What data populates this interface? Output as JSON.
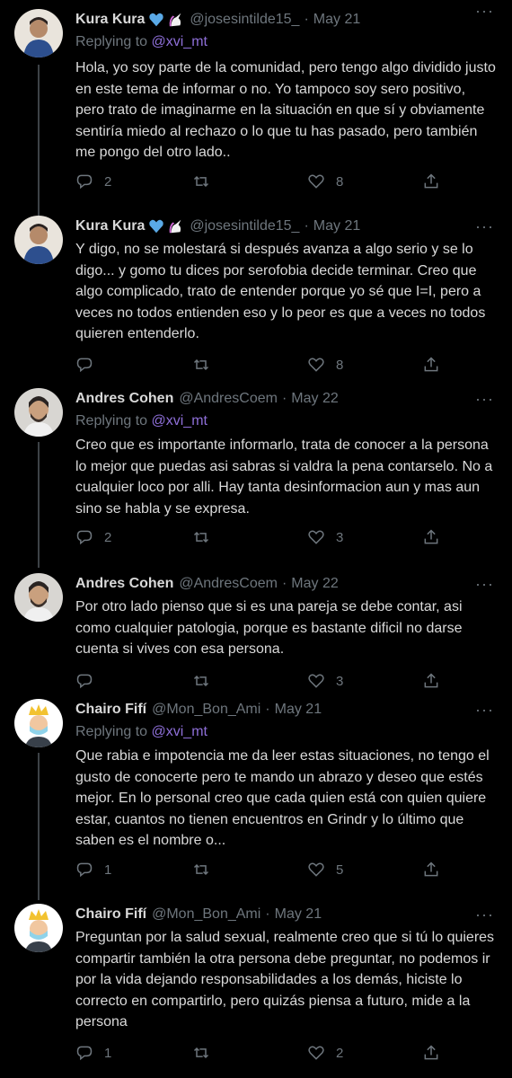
{
  "tweets": [
    {
      "name": "Kura Kura",
      "handle": "@josesintilde15_",
      "date": "May 21",
      "reply_prefix": "Replying to",
      "reply_to": "@xvi_mt",
      "text": "Hola, yo soy parte de la comunidad, pero tengo algo dividido justo en este tema de informar o no. Yo tampoco soy sero positivo, pero trato de imaginarme en la situación en que sí y obviamente sentiría miedo al rechazo o lo que tu has pasado, pero también me pongo del otro lado..",
      "replies": "2",
      "retweets": "",
      "likes": "8"
    },
    {
      "name": "Kura Kura",
      "handle": "@josesintilde15_",
      "date": "May 21",
      "text": "Y digo, no se molestará si después avanza a algo serio y se lo digo... y gomo tu dices por serofobia decide terminar. Creo que algo complicado, trato de entender porque yo sé que I=I, pero a veces no todos entienden eso y lo peor es que a veces no todos quieren entenderlo.",
      "replies": "",
      "retweets": "",
      "likes": "8"
    },
    {
      "name": "Andres Cohen",
      "handle": "@AndresCoem",
      "date": "May 22",
      "reply_prefix": "Replying to",
      "reply_to": "@xvi_mt",
      "text": "Creo que es importante informarlo, trata de conocer a la persona lo mejor que puedas asi sabras si valdra la pena contarselo. No a cualquier loco por alli. Hay tanta desinformacion aun y mas aun sino se habla y se expresa.",
      "replies": "2",
      "retweets": "",
      "likes": "3"
    },
    {
      "name": "Andres Cohen",
      "handle": "@AndresCoem",
      "date": "May 22",
      "text": "Por otro lado pienso que si es una pareja se debe contar, asi como cualquier patologia, porque es bastante dificil no darse cuenta si vives con esa persona.",
      "replies": "",
      "retweets": "",
      "likes": "3"
    },
    {
      "name": "Chairo Fifí",
      "handle": "@Mon_Bon_Ami",
      "date": "May 21",
      "reply_prefix": "Replying to",
      "reply_to": "@xvi_mt",
      "text": "Que rabia e impotencia me da leer estas situaciones, no tengo el gusto de conocerte pero te mando un abrazo y deseo que estés mejor. En lo personal creo que cada quien está con quien quiere estar, cuantos no tienen encuentros en Grindr y lo último que saben es el nombre o...",
      "replies": "1",
      "retweets": "",
      "likes": "5"
    },
    {
      "name": "Chairo Fifí",
      "handle": "@Mon_Bon_Ami",
      "date": "May 21",
      "text": "Preguntan por la salud sexual, realmente creo que si tú lo quieres compartir también la otra persona debe preguntar, no podemos ir por la vida dejando responsabilidades a los demás, hiciste lo correcto en compartirlo, pero quizás piensa a futuro, mide a la persona",
      "replies": "1",
      "retweets": "",
      "likes": "2"
    }
  ],
  "separator": "·",
  "more": "···",
  "icons": {
    "reply": "reply-icon",
    "retweet": "retweet-icon",
    "like": "heart-icon",
    "share": "share-icon",
    "blue_heart": "blue-heart-icon",
    "unicorn": "unicorn-icon"
  },
  "colors": {
    "background": "#000000",
    "text": "#d9d9d9",
    "muted": "#6e767d",
    "mention": "#8e6fd8"
  }
}
